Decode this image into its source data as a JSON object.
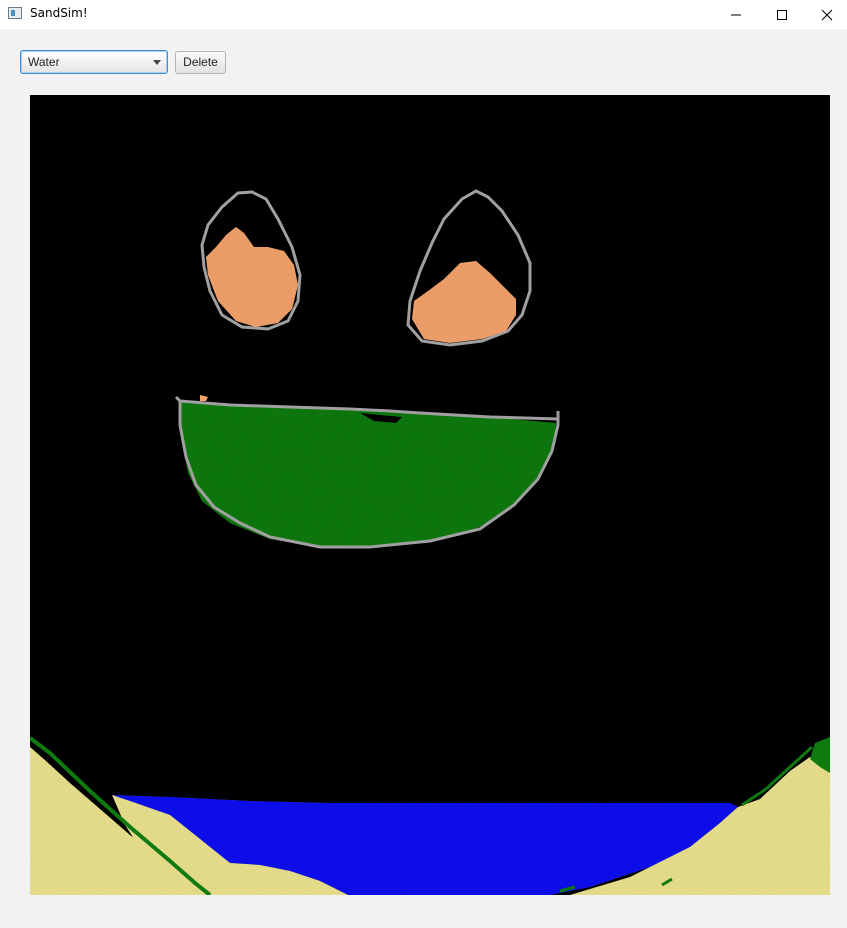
{
  "window": {
    "title": "SandSim!",
    "minimize_icon": "minimize-icon",
    "maximize_icon": "maximize-icon",
    "close_icon": "close-icon"
  },
  "toolbar": {
    "material_select": {
      "value": "Water",
      "arrow_icon": "chevron-down-icon"
    },
    "delete_label": "Delete"
  },
  "canvas": {
    "background": "#000000",
    "materials": {
      "sand": "#ece38f",
      "water": "#0a12f2",
      "plant": "#0f7a0f",
      "wall": "#a0a0a0",
      "orange": "#f4a36c"
    }
  }
}
